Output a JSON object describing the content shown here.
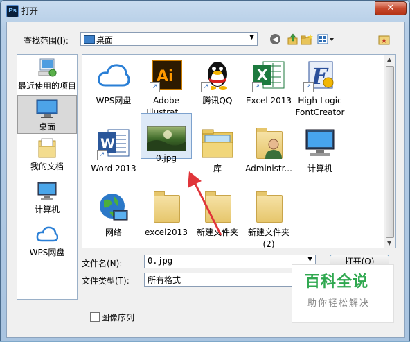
{
  "window": {
    "title": "打开",
    "app_icon": "Ps",
    "close_glyph": "✕"
  },
  "toolbar": {
    "lookin_label": "查找范围(I):",
    "lookin_value": "桌面",
    "icons": [
      "back-icon",
      "up-folder-icon",
      "new-folder-icon",
      "view-menu-icon",
      "extra-folder-icon"
    ]
  },
  "places": [
    {
      "label": "最近使用的项目",
      "icon": "recent-items-icon"
    },
    {
      "label": "桌面",
      "icon": "desktop-icon",
      "selected": true
    },
    {
      "label": "我的文档",
      "icon": "documents-icon"
    },
    {
      "label": "计算机",
      "icon": "computer-icon"
    },
    {
      "label": "WPS网盘",
      "icon": "cloud-icon"
    }
  ],
  "files": [
    {
      "label": "WPS网盘",
      "icon": "cloud-icon"
    },
    {
      "label": "Adobe Illustrat...",
      "line1": "Adobe",
      "line2": "Illustrat...",
      "icon": "illustrator-icon"
    },
    {
      "label": "腾讯QQ",
      "icon": "qq-penguin-icon"
    },
    {
      "label": "Excel 2013",
      "icon": "excel-icon"
    },
    {
      "label": "High-Logic FontCreator",
      "line1": "High-Logic",
      "line2": "FontCreator",
      "icon": "fontcreator-icon"
    },
    {
      "label": "Word 2013",
      "icon": "word-icon"
    },
    {
      "label": "0.jpg",
      "icon": "image-thumbnail-icon",
      "selected": true
    },
    {
      "label": "库",
      "icon": "library-icon"
    },
    {
      "label": "Administr...",
      "icon": "user-folder-icon"
    },
    {
      "label": "计算机",
      "icon": "computer-icon"
    },
    {
      "label": "网络",
      "icon": "network-globe-icon"
    },
    {
      "label": "excel2013",
      "icon": "folder-icon"
    },
    {
      "label": "新建文件夹",
      "icon": "folder-icon"
    },
    {
      "label": "新建文件夹 (2)",
      "line1": "新建文件夹",
      "line2": "(2)",
      "icon": "folder-icon"
    }
  ],
  "form": {
    "filename_label": "文件名(N):",
    "filename_value": "0.jpg",
    "filetype_label": "文件类型(T):",
    "filetype_value": "所有格式",
    "open_button": "打开(O)",
    "sequence_label": "图像序列",
    "sequence_checked": false
  },
  "watermark": {
    "title": "百科全说",
    "subtitle": "助你轻松解决"
  },
  "colors": {
    "accent": "#3c7fb1",
    "arrow": "#e0353a",
    "watermark_green": "#2fa84f"
  }
}
